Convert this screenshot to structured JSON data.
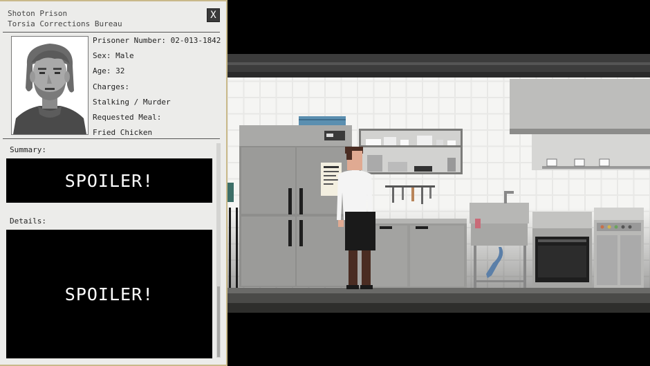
{
  "dossier": {
    "prison_name": "Shoton Prison",
    "bureau": "Torsia Corrections Bureau",
    "close_label": "X",
    "fields": [
      {
        "text": "Prisoner Number: 02-013-1842"
      },
      {
        "text": "Sex: Male"
      },
      {
        "text": "Age: 32"
      },
      {
        "text": "Charges:"
      },
      {
        "text": "Stalking / Murder"
      },
      {
        "text": "Requested Meal:"
      },
      {
        "text": "Fried Chicken"
      }
    ],
    "summary_label": "Summary:",
    "summary_text": "SPOILER!",
    "details_label": "Details:",
    "details_text": "SPOILER!"
  },
  "colors": {
    "panel_bg": "#ececea",
    "panel_border": "#c9b98a",
    "spoiler_bg": "#000000",
    "tile_wall": "#f2f2f0",
    "appliance_gray": "#8e8e8c",
    "chef_coat": "#f4f4f4",
    "chef_apron": "#1a1a1a",
    "shelf_box": "#5b8fb0"
  }
}
